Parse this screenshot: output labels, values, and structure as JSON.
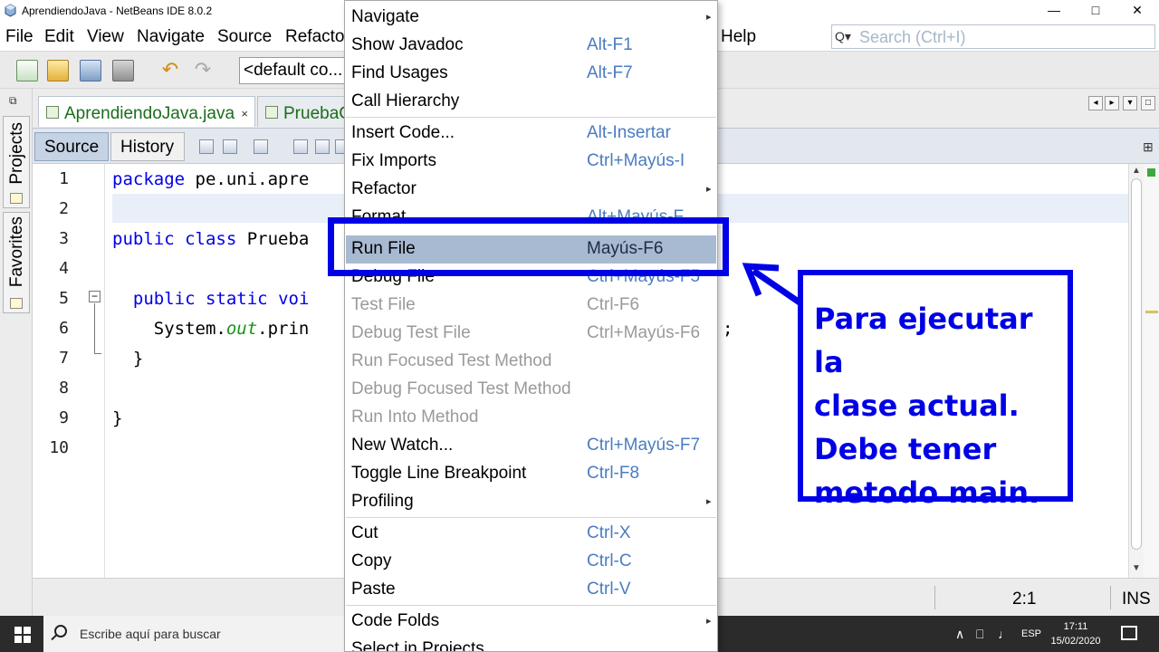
{
  "window": {
    "title": "AprendiendoJava - NetBeans IDE 8.0.2",
    "controls": {
      "minimize": "—",
      "maximize": "□",
      "close": "✕"
    }
  },
  "menubar": {
    "items": [
      "File",
      "Edit",
      "View",
      "Navigate",
      "Source",
      "Refacto",
      "Help"
    ],
    "search_placeholder": "Search (Ctrl+I)",
    "search_icon": "Q▾"
  },
  "toolbar": {
    "config_value": "<default co...",
    "undo_glyph": "↶",
    "redo_glyph": "↷"
  },
  "sidebar": {
    "restore_glyph": "⧉",
    "tabs": [
      "Projects",
      "Favorites"
    ]
  },
  "editor_tabs": {
    "tabs": [
      {
        "label": "AprendiendoJava.java",
        "close": "×"
      },
      {
        "label": "PruebaC"
      }
    ],
    "nav_glyphs": [
      "◂",
      "▸",
      "▾",
      "□"
    ]
  },
  "editor_toolbar": {
    "source_label": "Source",
    "history_label": "History",
    "split_glyph": "⊞"
  },
  "code": {
    "line_numbers": [
      "1",
      "2",
      "3",
      "4",
      "5",
      "6",
      "7",
      "8",
      "9",
      "10"
    ],
    "line1": {
      "kw": "package",
      "rest": " pe.uni.apre"
    },
    "line3": {
      "kw1": "public",
      "kw2": "class",
      "rest": " Prueba"
    },
    "line5": {
      "kw1": "public",
      "kw2": "static",
      "kw3": "voi"
    },
    "line6": {
      "a": "System.",
      "it": "out",
      "b": ".prin",
      "tail": ";"
    },
    "line7": "}",
    "line9": "}",
    "fold_glyph": "−"
  },
  "scrollbar": {
    "up": "▲",
    "down": "▼"
  },
  "statusbar": {
    "position": "2:1",
    "mode": "INS"
  },
  "taskbar": {
    "search_text": "Escribe aquí para buscar",
    "tray": {
      "chevron": "∧",
      "network": "⎕",
      "volume": "♩",
      "lang": "ESP"
    },
    "time": "17:11",
    "date": "15/02/2020"
  },
  "context_menu": {
    "items": [
      {
        "label": "Navigate",
        "shortcut": "",
        "sub": "▸"
      },
      {
        "label": "Show Javadoc",
        "shortcut": "Alt-F1"
      },
      {
        "label": "Find Usages",
        "shortcut": "Alt-F7"
      },
      {
        "label": "Call Hierarchy",
        "shortcut": ""
      },
      {
        "label": "Insert Code...",
        "shortcut": "Alt-Insertar"
      },
      {
        "label": "Fix Imports",
        "shortcut": "Ctrl+Mayús-I"
      },
      {
        "label": "Refactor",
        "shortcut": "",
        "sub": "▸"
      },
      {
        "label": "Format",
        "shortcut": "Alt+Mayús-F"
      },
      {
        "label": "Run File",
        "shortcut": "Mayús-F6"
      },
      {
        "label": "Debug File",
        "shortcut": "Ctrl+Mayús-F5"
      },
      {
        "label": "Test File",
        "shortcut": "Ctrl-F6"
      },
      {
        "label": "Debug Test File",
        "shortcut": "Ctrl+Mayús-F6"
      },
      {
        "label": "Run Focused Test Method",
        "shortcut": ""
      },
      {
        "label": "Debug Focused Test Method",
        "shortcut": ""
      },
      {
        "label": "Run Into Method",
        "shortcut": ""
      },
      {
        "label": "New Watch...",
        "shortcut": "Ctrl+Mayús-F7"
      },
      {
        "label": "Toggle Line Breakpoint",
        "shortcut": "Ctrl-F8"
      },
      {
        "label": "Profiling",
        "shortcut": "",
        "sub": "▸"
      },
      {
        "label": "Cut",
        "shortcut": "Ctrl-X"
      },
      {
        "label": "Copy",
        "shortcut": "Ctrl-C"
      },
      {
        "label": "Paste",
        "shortcut": "Ctrl-V"
      },
      {
        "label": "Code Folds",
        "shortcut": "",
        "sub": "▸"
      },
      {
        "label": "Select in Projects",
        "shortcut": ""
      }
    ]
  },
  "annotation": {
    "lines": [
      "Para ejecutar la",
      "clase actual.",
      "Debe tener",
      "metodo main."
    ],
    "color": "#0000e6"
  }
}
